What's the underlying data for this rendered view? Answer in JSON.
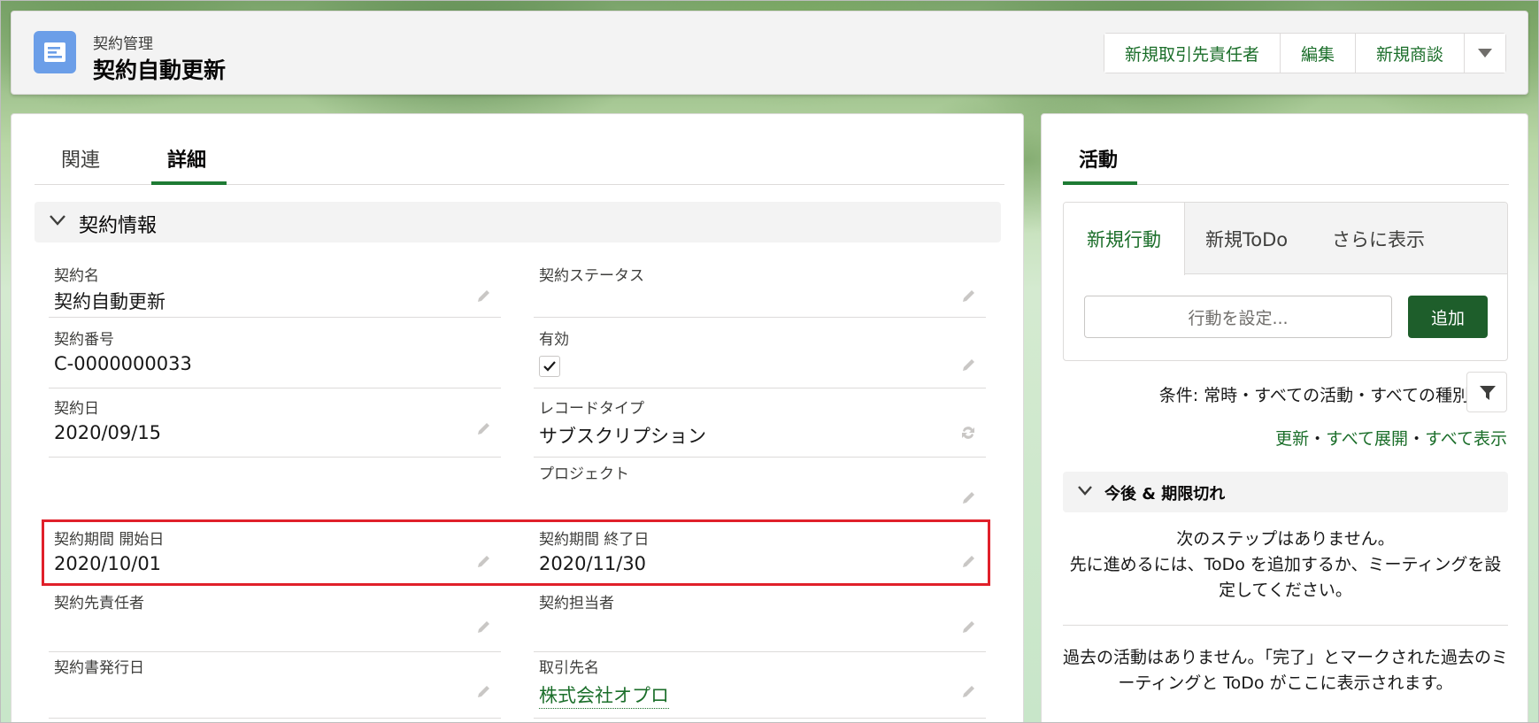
{
  "header": {
    "object_type": "契約管理",
    "record_title": "契約自動更新",
    "actions": [
      "新規取引先責任者",
      "編集",
      "新規商談"
    ],
    "icon": "contract-icon"
  },
  "tabs": {
    "related": "関連",
    "details": "詳細"
  },
  "section": {
    "title": "契約情報"
  },
  "fields": {
    "contract_name": {
      "label": "契約名",
      "value": "契約自動更新"
    },
    "contract_status": {
      "label": "契約ステータス",
      "value": ""
    },
    "contract_number": {
      "label": "契約番号",
      "value": "C-0000000033"
    },
    "active": {
      "label": "有効",
      "checked": true
    },
    "contract_date": {
      "label": "契約日",
      "value": "2020/09/15"
    },
    "record_type": {
      "label": "レコードタイプ",
      "value": "サブスクリプション"
    },
    "project": {
      "label": "プロジェクト",
      "value": ""
    },
    "start_date": {
      "label": "契約期間 開始日",
      "value": "2020/10/01"
    },
    "end_date": {
      "label": "契約期間 終了日",
      "value": "2020/11/30"
    },
    "customer_contact": {
      "label": "契約先責任者",
      "value": ""
    },
    "owner": {
      "label": "契約担当者",
      "value": ""
    },
    "issue_date": {
      "label": "契約書発行日",
      "value": ""
    },
    "account_name": {
      "label": "取引先名",
      "value": "株式会社オプロ"
    }
  },
  "activity": {
    "tab": "活動",
    "publisher_tabs": [
      "新規行動",
      "新規ToDo",
      "さらに表示"
    ],
    "input_placeholder": "行動を設定...",
    "add_label": "追加",
    "filter_text": "条件: 常時・すべての活動・すべての種別",
    "link_refresh": "更新",
    "link_expand": "すべて展開",
    "link_show_all": "すべて表示",
    "separator": "・",
    "upcoming_title": "今後 & 期限切れ",
    "no_next_steps": "次のステップはありません。",
    "next_steps_hint": "先に進めるには、ToDo を追加するか、ミーティングを設定してください。",
    "no_past_activity": "過去の活動はありません。「完了」とマークされた過去のミーティングと ToDo がここに表示されます。"
  }
}
